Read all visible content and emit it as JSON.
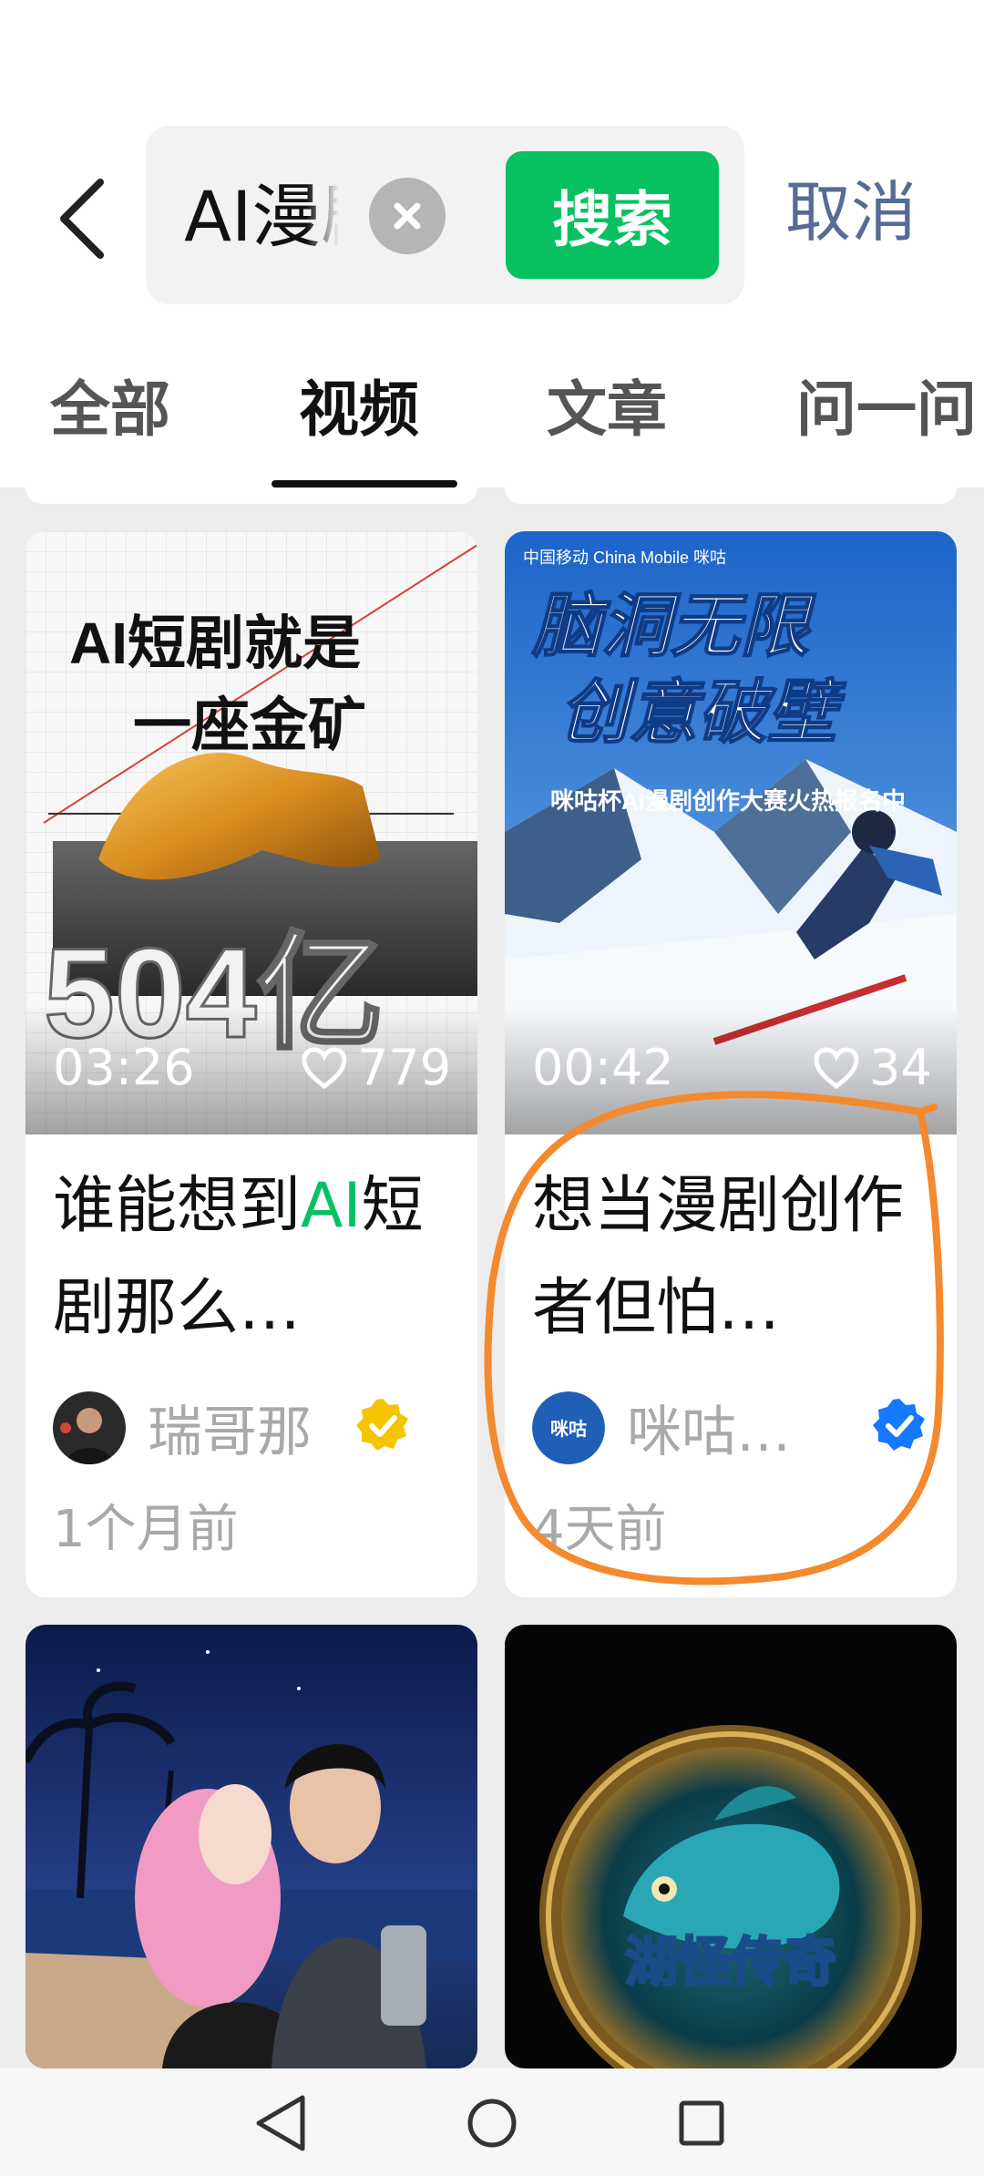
{
  "header": {
    "search_value": "AI漫剧",
    "search_button": "搜索",
    "cancel": "取消"
  },
  "tabs": [
    {
      "label": "全部",
      "active": false
    },
    {
      "label": "视频",
      "active": true
    },
    {
      "label": "文章",
      "active": false
    },
    {
      "label": "问一问",
      "active": false
    }
  ],
  "cards": [
    {
      "thumb_headline_1": "AI短剧就是",
      "thumb_headline_2": "一座金矿",
      "thumb_big_text": "504亿",
      "duration": "03:26",
      "likes": "779",
      "title_pre": "谁能想到",
      "title_highlight": "AI",
      "title_post": "短剧那么…",
      "author": "瑞哥那",
      "time": "1个月前",
      "verified_color": "#f5c400"
    },
    {
      "thumb_logo": "中国移动 China Mobile 咪咕",
      "thumb_headline_1": "脑洞无限",
      "thumb_headline_2": "创意破壁",
      "thumb_subline": "咪咕杯AI漫剧创作大赛火热报名中",
      "duration": "00:42",
      "likes": "34",
      "title": "想当漫剧创作者但怕…",
      "author": "咪咕…",
      "time": "4天前",
      "verified_color": "#1677ff",
      "annotation_color": "#f4892e"
    },
    {
      "thumb_theme": "couple-beach"
    },
    {
      "thumb_badge_text": "湖怪传奇"
    }
  ],
  "colors": {
    "accent_green": "#07c160",
    "cancel_blue": "#576b95",
    "background": "#ededed"
  }
}
